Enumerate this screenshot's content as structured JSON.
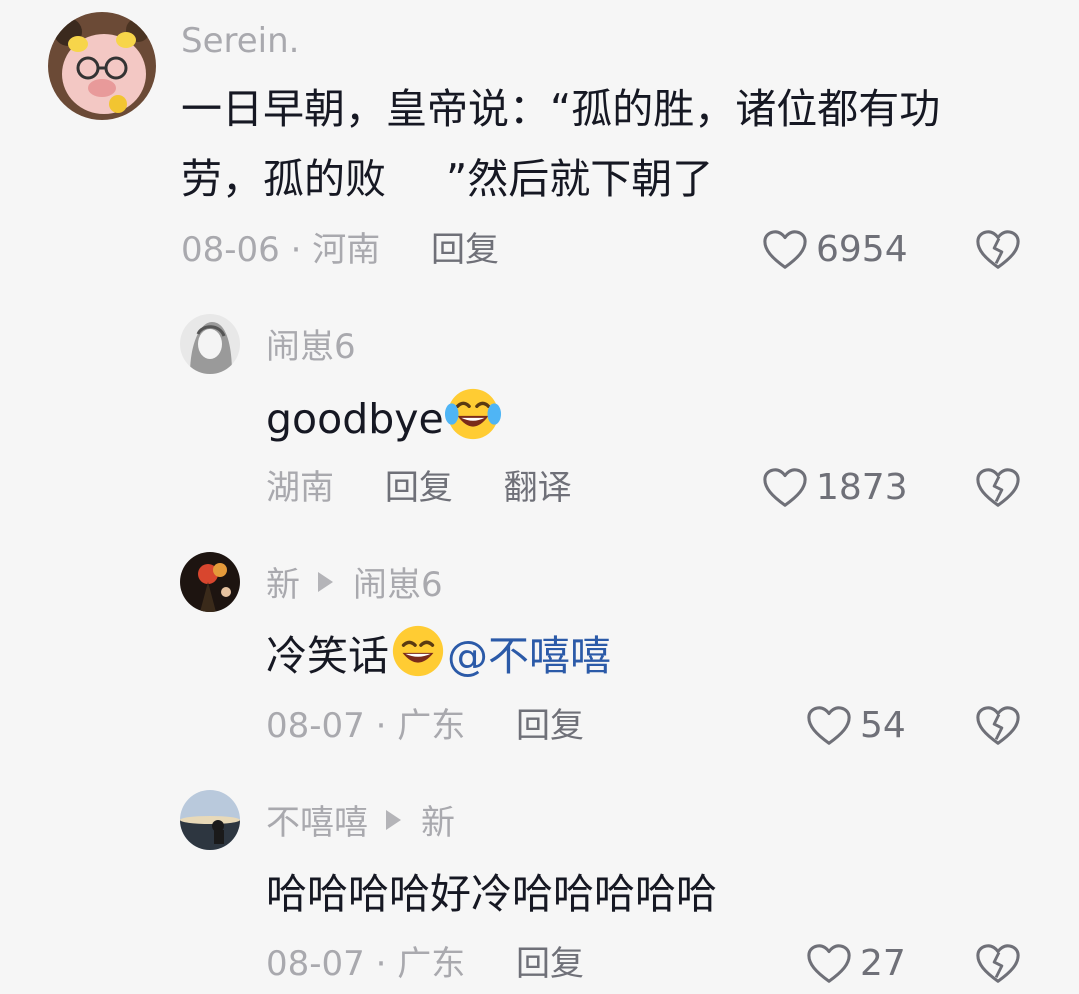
{
  "comments": [
    {
      "author": "Serein.",
      "text_before": "一日早朝，皇帝说：“孤的胜，诸位都有功劳，孤的败",
      "text_after": "”然后就下朝了",
      "date": "08-06",
      "location": "河南",
      "reply_label": "回复",
      "likes": "6954"
    },
    {
      "author": "闹崽6",
      "text": "goodbye",
      "emoji": "laughing-tears-emoji",
      "location": "湖南",
      "reply_label": "回复",
      "translate_label": "翻译",
      "likes": "1873"
    },
    {
      "author": "新",
      "reply_to": "闹崽6",
      "text": "冷笑话",
      "emoji": "grinning-smile-emoji",
      "mention": "@不嘻嘻",
      "date": "08-07",
      "location": "广东",
      "reply_label": "回复",
      "likes": "54"
    },
    {
      "author": "不嘻嘻",
      "reply_to": "新",
      "text": "哈哈哈哈好冷哈哈哈哈哈",
      "date": "08-07",
      "location": "广东",
      "reply_label": "回复",
      "likes": "27"
    }
  ],
  "separator": "·",
  "colors": {
    "background": "#f6f6f6",
    "text": "#161823",
    "meta": "#a9a9ae",
    "action": "#6f7078",
    "mention": "#2b5aa8"
  }
}
